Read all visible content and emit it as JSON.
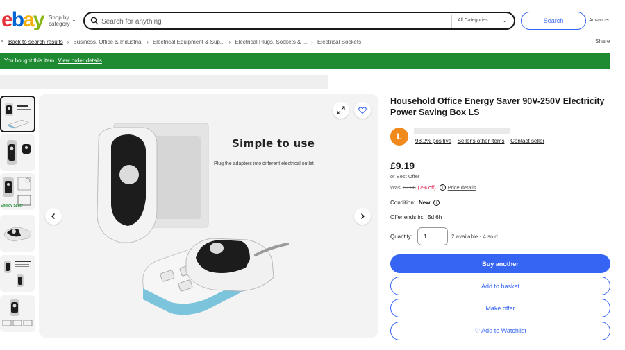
{
  "header": {
    "logo": {
      "e": "e",
      "b": "b",
      "a": "a",
      "y": "y"
    },
    "shop_by": [
      "Shop by",
      "category"
    ],
    "search_placeholder": "Search for anything",
    "category": "All Categories",
    "search_label": "Search",
    "advanced_label": "Advanced"
  },
  "breadcrumb": {
    "back": "Back to search results",
    "items": [
      "Business, Office & Industrial",
      "Electrical Equipment & Sup...",
      "Electrical Plugs, Sockets & ...",
      "Electrical Sockets"
    ],
    "share": "Share"
  },
  "banner": {
    "text": "You bought this item.",
    "link": "View order details",
    "color": "#1e8a32"
  },
  "gallery": {
    "image_heading": "Simple to use",
    "image_caption": "Plug the adapters into different electrical outlet",
    "thumb_badge": "Energy Saver"
  },
  "product": {
    "title": "Household Office Energy Saver 90V-250V Electricity Power Saving Box LS",
    "seller_initial": "L",
    "seller_feedback": "98.2% positive",
    "seller_items": "Seller's other items",
    "contact_seller": "Contact seller",
    "price": "£9.19",
    "best_offer": "or Best Offer",
    "was_label": "Was",
    "was_price": "£9.88",
    "discount": "(7% off)",
    "price_details": "Price details",
    "condition_label": "Condition:",
    "condition_value": "New",
    "offer_ends_label": "Offer ends in:",
    "offer_ends_value": "5d 6h",
    "quantity_label": "Quantity:",
    "quantity_value": "1",
    "availability": "2 available · 4 sold"
  },
  "actions": {
    "buy_another": "Buy another",
    "add_to_basket": "Add to basket",
    "make_offer": "Make offer",
    "add_to_watchlist": "♡ Add to Watchlist"
  },
  "colors": {
    "accent": "#3665f3",
    "discount": "#e0103a",
    "avatar": "#f08a1c"
  }
}
